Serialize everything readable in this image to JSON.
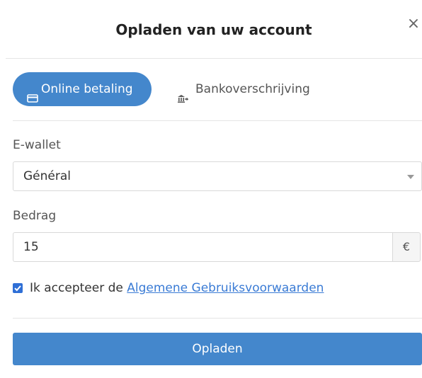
{
  "modal": {
    "title": "Opladen van uw account",
    "close_glyph": "×"
  },
  "tabs": [
    {
      "label": "Online betaling",
      "icon": "credit-card-icon",
      "active": true
    },
    {
      "label": "Bankoverschrijving",
      "icon": "bank-transfer-icon",
      "active": false
    }
  ],
  "wallet": {
    "label": "E-wallet",
    "selected": "Général"
  },
  "amount": {
    "label": "Bedrag",
    "value": "15",
    "currency": "€"
  },
  "terms": {
    "checked": true,
    "prefix": "Ik accepteer de ",
    "link_text": "Algemene Gebruiksvoorwaarden"
  },
  "submit": {
    "label": "Opladen"
  },
  "colors": {
    "primary": "#4487cc",
    "link": "#3a7bd5",
    "checkbox": "#2f6fd6",
    "border": "#d9d9d9"
  }
}
